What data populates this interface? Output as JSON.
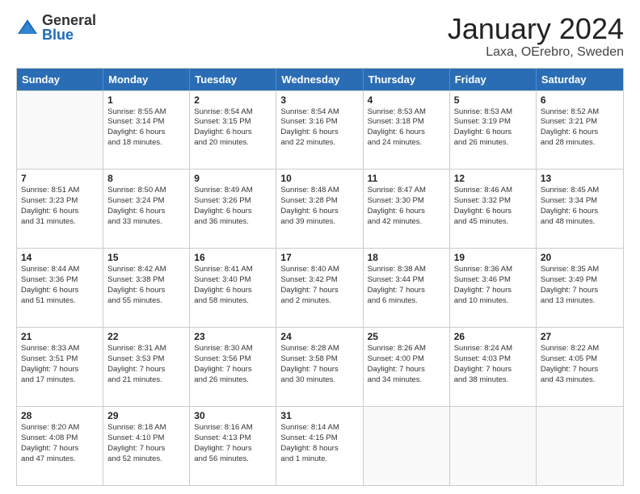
{
  "header": {
    "logo_general": "General",
    "logo_blue": "Blue",
    "month_title": "January 2024",
    "location": "Laxa, OErebro, Sweden"
  },
  "weekdays": [
    "Sunday",
    "Monday",
    "Tuesday",
    "Wednesday",
    "Thursday",
    "Friday",
    "Saturday"
  ],
  "weeks": [
    [
      {
        "day": "",
        "info": ""
      },
      {
        "day": "1",
        "info": "Sunrise: 8:55 AM\nSunset: 3:14 PM\nDaylight: 6 hours\nand 18 minutes."
      },
      {
        "day": "2",
        "info": "Sunrise: 8:54 AM\nSunset: 3:15 PM\nDaylight: 6 hours\nand 20 minutes."
      },
      {
        "day": "3",
        "info": "Sunrise: 8:54 AM\nSunset: 3:16 PM\nDaylight: 6 hours\nand 22 minutes."
      },
      {
        "day": "4",
        "info": "Sunrise: 8:53 AM\nSunset: 3:18 PM\nDaylight: 6 hours\nand 24 minutes."
      },
      {
        "day": "5",
        "info": "Sunrise: 8:53 AM\nSunset: 3:19 PM\nDaylight: 6 hours\nand 26 minutes."
      },
      {
        "day": "6",
        "info": "Sunrise: 8:52 AM\nSunset: 3:21 PM\nDaylight: 6 hours\nand 28 minutes."
      }
    ],
    [
      {
        "day": "7",
        "info": "Sunrise: 8:51 AM\nSunset: 3:23 PM\nDaylight: 6 hours\nand 31 minutes."
      },
      {
        "day": "8",
        "info": "Sunrise: 8:50 AM\nSunset: 3:24 PM\nDaylight: 6 hours\nand 33 minutes."
      },
      {
        "day": "9",
        "info": "Sunrise: 8:49 AM\nSunset: 3:26 PM\nDaylight: 6 hours\nand 36 minutes."
      },
      {
        "day": "10",
        "info": "Sunrise: 8:48 AM\nSunset: 3:28 PM\nDaylight: 6 hours\nand 39 minutes."
      },
      {
        "day": "11",
        "info": "Sunrise: 8:47 AM\nSunset: 3:30 PM\nDaylight: 6 hours\nand 42 minutes."
      },
      {
        "day": "12",
        "info": "Sunrise: 8:46 AM\nSunset: 3:32 PM\nDaylight: 6 hours\nand 45 minutes."
      },
      {
        "day": "13",
        "info": "Sunrise: 8:45 AM\nSunset: 3:34 PM\nDaylight: 6 hours\nand 48 minutes."
      }
    ],
    [
      {
        "day": "14",
        "info": "Sunrise: 8:44 AM\nSunset: 3:36 PM\nDaylight: 6 hours\nand 51 minutes."
      },
      {
        "day": "15",
        "info": "Sunrise: 8:42 AM\nSunset: 3:38 PM\nDaylight: 6 hours\nand 55 minutes."
      },
      {
        "day": "16",
        "info": "Sunrise: 8:41 AM\nSunset: 3:40 PM\nDaylight: 6 hours\nand 58 minutes."
      },
      {
        "day": "17",
        "info": "Sunrise: 8:40 AM\nSunset: 3:42 PM\nDaylight: 7 hours\nand 2 minutes."
      },
      {
        "day": "18",
        "info": "Sunrise: 8:38 AM\nSunset: 3:44 PM\nDaylight: 7 hours\nand 6 minutes."
      },
      {
        "day": "19",
        "info": "Sunrise: 8:36 AM\nSunset: 3:46 PM\nDaylight: 7 hours\nand 10 minutes."
      },
      {
        "day": "20",
        "info": "Sunrise: 8:35 AM\nSunset: 3:49 PM\nDaylight: 7 hours\nand 13 minutes."
      }
    ],
    [
      {
        "day": "21",
        "info": "Sunrise: 8:33 AM\nSunset: 3:51 PM\nDaylight: 7 hours\nand 17 minutes."
      },
      {
        "day": "22",
        "info": "Sunrise: 8:31 AM\nSunset: 3:53 PM\nDaylight: 7 hours\nand 21 minutes."
      },
      {
        "day": "23",
        "info": "Sunrise: 8:30 AM\nSunset: 3:56 PM\nDaylight: 7 hours\nand 26 minutes."
      },
      {
        "day": "24",
        "info": "Sunrise: 8:28 AM\nSunset: 3:58 PM\nDaylight: 7 hours\nand 30 minutes."
      },
      {
        "day": "25",
        "info": "Sunrise: 8:26 AM\nSunset: 4:00 PM\nDaylight: 7 hours\nand 34 minutes."
      },
      {
        "day": "26",
        "info": "Sunrise: 8:24 AM\nSunset: 4:03 PM\nDaylight: 7 hours\nand 38 minutes."
      },
      {
        "day": "27",
        "info": "Sunrise: 8:22 AM\nSunset: 4:05 PM\nDaylight: 7 hours\nand 43 minutes."
      }
    ],
    [
      {
        "day": "28",
        "info": "Sunrise: 8:20 AM\nSunset: 4:08 PM\nDaylight: 7 hours\nand 47 minutes."
      },
      {
        "day": "29",
        "info": "Sunrise: 8:18 AM\nSunset: 4:10 PM\nDaylight: 7 hours\nand 52 minutes."
      },
      {
        "day": "30",
        "info": "Sunrise: 8:16 AM\nSunset: 4:13 PM\nDaylight: 7 hours\nand 56 minutes."
      },
      {
        "day": "31",
        "info": "Sunrise: 8:14 AM\nSunset: 4:15 PM\nDaylight: 8 hours\nand 1 minute."
      },
      {
        "day": "",
        "info": ""
      },
      {
        "day": "",
        "info": ""
      },
      {
        "day": "",
        "info": ""
      }
    ]
  ]
}
